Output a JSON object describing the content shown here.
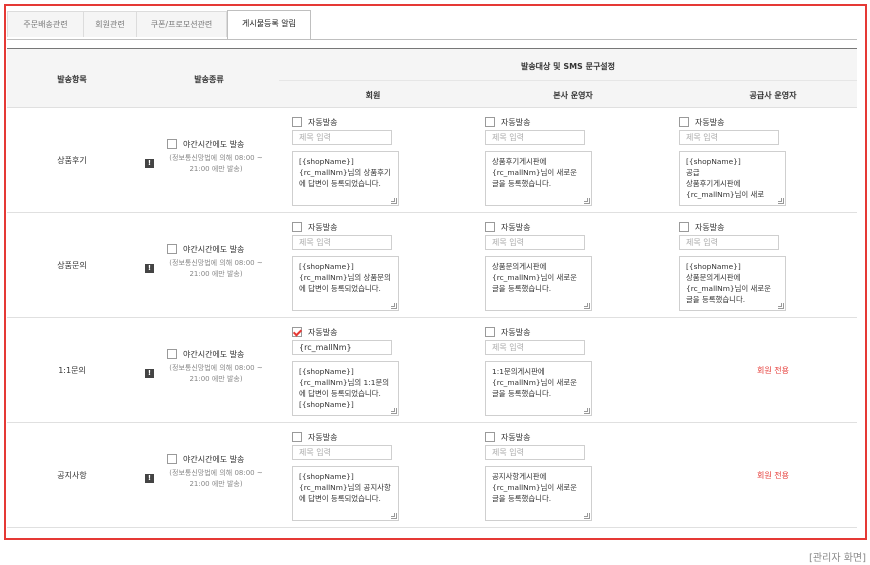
{
  "tabs": [
    "주문배송관련",
    "회원관련",
    "쿠폰/프로모션관련",
    "게시물등록 알림"
  ],
  "active_tab_index": 3,
  "header": {
    "item": "발송항목",
    "kind": "발송종류",
    "target": "발송대상 및 SMS 문구설정",
    "member": "회원",
    "hq": "본사 운영자",
    "supplier": "공급사 운영자"
  },
  "rows": [
    {
      "item": "상품후기",
      "night_label": "야간시간에도 발송",
      "night_checked": false,
      "notice": "(정보통신망법에 의해 08:00 ~ 21:00 에만 발송)",
      "member": {
        "auto_label": "자동발송",
        "auto_checked": false,
        "title_placeholder": "제목 입력",
        "title_value": "",
        "message": "[{shopName}]\n{rc_mallNm}님의 상품후기에 답변이 등록되었습니다."
      },
      "hq": {
        "auto_label": "자동발송",
        "auto_checked": false,
        "title_placeholder": "제목 입력",
        "title_value": "",
        "message": "상품후기게시판에\n{rc_mallNm}님이 새로운 글을 등록했습니다."
      },
      "supplier": {
        "auto_label": "자동발송",
        "auto_checked": false,
        "title_placeholder": "제목 입력",
        "title_value": "",
        "message": "[{shopName}]\n공급\n상품후기게시판에\n{rc_mallNm}님이 새로"
      },
      "supplier_only_text": ""
    },
    {
      "item": "상품문의",
      "night_label": "야간시간에도 발송",
      "night_checked": false,
      "notice": "(정보통신망법에 의해 08:00 ~ 21:00 에만 발송)",
      "member": {
        "auto_label": "자동발송",
        "auto_checked": false,
        "title_placeholder": "제목 입력",
        "title_value": "",
        "message": "[{shopName}]\n{rc_mallNm}님의 상품문의에 답변이 등록되었습니다."
      },
      "hq": {
        "auto_label": "자동발송",
        "auto_checked": false,
        "title_placeholder": "제목 입력",
        "title_value": "",
        "message": "상품문의게시판에\n{rc_mallNm}님이 새로운 글을 등록했습니다."
      },
      "supplier": {
        "auto_label": "자동발송",
        "auto_checked": false,
        "title_placeholder": "제목 입력",
        "title_value": "",
        "message": "[{shopName}]\n상품문의게시판에\n{rc_mallNm}님이 새로운 글을 등록했습니다."
      },
      "supplier_only_text": ""
    },
    {
      "item": "1:1문의",
      "night_label": "야간시간에도 발송",
      "night_checked": false,
      "notice": "(정보통신망법에 의해 08:00 ~ 21:00 에만 발송)",
      "member": {
        "auto_label": "자동발송",
        "auto_checked": true,
        "title_placeholder": "제목 입력",
        "title_value": "{rc_mallNm}",
        "message": "[{shopName}]\n{rc_mallNm}님의 1:1문의에 답변이 등록되었습니다. [{shopName}]"
      },
      "hq": {
        "auto_label": "자동발송",
        "auto_checked": false,
        "title_placeholder": "제목 입력",
        "title_value": "",
        "message": "1:1문의게시판에\n{rc_mallNm}님이 새로운 글을 등록했습니다."
      },
      "supplier": null,
      "supplier_only_text": "회원 전용"
    },
    {
      "item": "공지사항",
      "night_label": "야간시간에도 발송",
      "night_checked": false,
      "notice": "(정보통신망법에 의해 08:00 ~ 21:00 에만 발송)",
      "member": {
        "auto_label": "자동발송",
        "auto_checked": false,
        "title_placeholder": "제목 입력",
        "title_value": "",
        "message": "[{shopName}]\n{rc_mallNm}님의 공지사항에 답변이 등록되었습니다."
      },
      "hq": {
        "auto_label": "자동발송",
        "auto_checked": false,
        "title_placeholder": "제목 입력",
        "title_value": "",
        "message": "공지사항게시판에\n{rc_mallNm}님이 새로운 글을 등록했습니다."
      },
      "supplier": null,
      "supplier_only_text": "회원 전용"
    }
  ],
  "caption": "[관리자 화면]",
  "colors": {
    "frame": "#e53935",
    "accent": "#e53935",
    "header_bg": "#f5f5f5"
  }
}
